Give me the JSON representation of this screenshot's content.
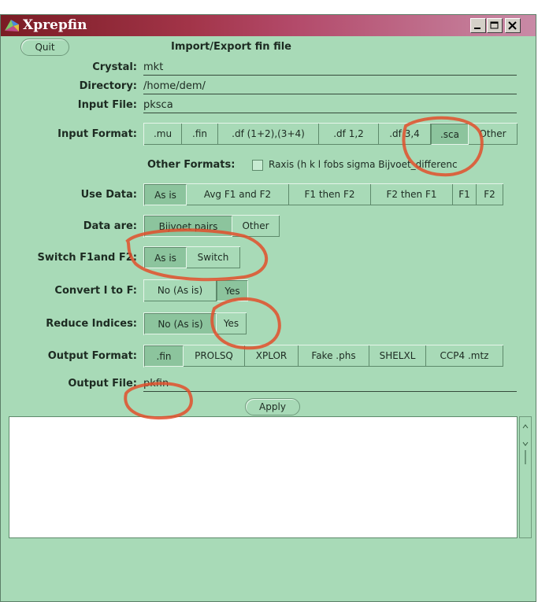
{
  "window": {
    "title": "Xprepfin"
  },
  "buttons": {
    "quit": "Quit",
    "apply": "Apply"
  },
  "header": "Import/Export fin file",
  "fields": {
    "crystal": {
      "label": "Crystal:",
      "value": "mkt"
    },
    "directory": {
      "label": "Directory:",
      "value": "/home/dem/"
    },
    "input_file": {
      "label": "Input File:",
      "value": "pksca"
    },
    "output_file": {
      "label": "Output File:",
      "value": "pkfin"
    }
  },
  "input_format": {
    "label": "Input Format:",
    "options": [
      ".mu",
      ".fin",
      ".df (1+2),(3+4)",
      ".df 1,2",
      ".df 3,4",
      ".sca",
      "Other"
    ],
    "selected": ".sca"
  },
  "other_formats": {
    "label": "Other Formats:",
    "text": "Raxis (h k l fobs sigma Bijvoet_differenc"
  },
  "use_data": {
    "label": "Use Data:",
    "options": [
      "As is",
      "Avg F1 and F2",
      "F1 then F2",
      "F2 then F1",
      "F1",
      "F2"
    ],
    "selected": "As is"
  },
  "data_are": {
    "label": "Data are:",
    "options": [
      "Bijvoet pairs",
      "Other"
    ],
    "selected": "Bijvoet pairs"
  },
  "switch_f1f2": {
    "label": "Switch F1and F2:",
    "options": [
      "As is",
      "Switch"
    ],
    "selected": "As is"
  },
  "convert_i_to_f": {
    "label": "Convert I to F:",
    "options": [
      "No (As is)",
      "Yes"
    ],
    "selected": "Yes"
  },
  "reduce_indices": {
    "label": "Reduce Indices:",
    "options": [
      "No (As is)",
      "Yes"
    ],
    "selected": "No (As is)"
  },
  "output_format": {
    "label": "Output Format:",
    "options": [
      ".fin",
      "PROLSQ",
      "XPLOR",
      "Fake .phs",
      "SHELXL",
      "CCP4 .mtz"
    ],
    "selected": ".fin"
  },
  "colors": {
    "panel_bg": "#a8dab7",
    "selected_bg": "#8cc49d",
    "annotation": "#e24f2c",
    "titlebar": "#8a2434"
  }
}
